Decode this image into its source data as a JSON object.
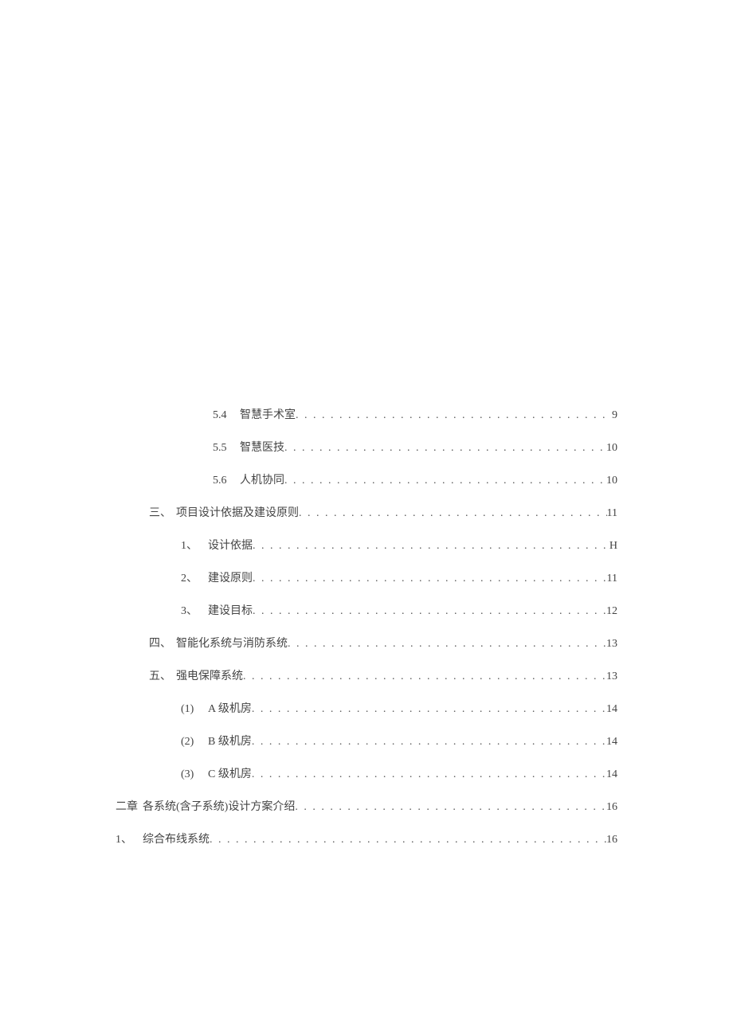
{
  "toc": [
    {
      "indent": 3,
      "label": "5.4",
      "title": "智慧手术室",
      "page": "9"
    },
    {
      "indent": 3,
      "label": "5.5",
      "title": "智慧医技",
      "page": "10"
    },
    {
      "indent": 3,
      "label": "5.6",
      "title": "人机协同",
      "page": "10"
    },
    {
      "indent": 1,
      "label": "三、",
      "title": "项目设计依据及建设原则",
      "page": "11"
    },
    {
      "indent": 2,
      "label": "1、",
      "title": "设计依据",
      "page": "H"
    },
    {
      "indent": 2,
      "label": "2、",
      "title": "建设原则",
      "page": "11"
    },
    {
      "indent": 2,
      "label": "3、",
      "title": "建设目标",
      "page": "12"
    },
    {
      "indent": 1,
      "label": "四、",
      "title": "智能化系统与消防系统",
      "page": "13"
    },
    {
      "indent": 1,
      "label": "五、",
      "title": "强电保障系统",
      "page": "13"
    },
    {
      "indent": 2,
      "label": "(1)",
      "title": "A 级机房",
      "page": "14"
    },
    {
      "indent": 2,
      "label": "(2)",
      "title": "B 级机房",
      "page": "14"
    },
    {
      "indent": 2,
      "label": "(3)",
      "title": "C 级机房",
      "page": "14"
    },
    {
      "indent": 0,
      "label": "二章",
      "title": "各系统(含子系统)设计方案介绍",
      "page": "16"
    },
    {
      "indent": 0,
      "label": "1、",
      "title": "综合布线系统",
      "page": "16"
    }
  ]
}
